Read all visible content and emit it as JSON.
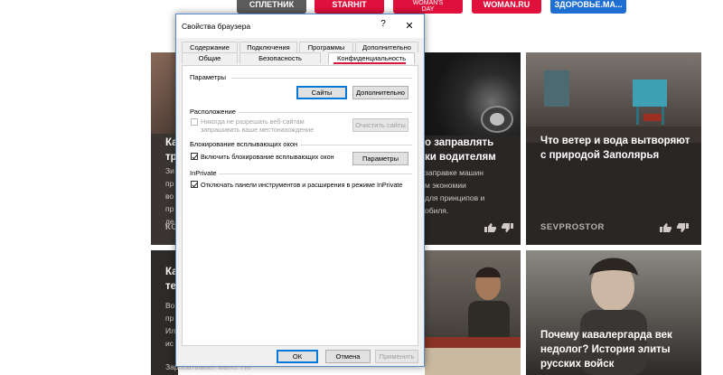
{
  "nav": {
    "items": [
      {
        "label": "СПЛЕТНИК",
        "color": "#5c5c5c"
      },
      {
        "label": "STARHIT",
        "color": "#e0103c"
      },
      {
        "label": "WOMAN'S DAY",
        "color": "#e0103c"
      },
      {
        "label": "WOMAN.RU",
        "color": "#e0103c"
      },
      {
        "label": "ЗДОРОВЬЕ.MA...",
        "color": "#1f6fd3"
      }
    ]
  },
  "cards": {
    "c1": {
      "title_start": "Ка",
      "title_start2": "тр",
      "desc": [
        "Зи",
        "пр",
        "во",
        "пр",
        "де"
      ],
      "source": "КО"
    },
    "c2": {
      "title": [
        "о заправлять",
        "ки водителям"
      ],
      "desc": [
        "заправке машин",
        "м экономии",
        "для принципов и",
        "обиля."
      ]
    },
    "c3": {
      "title": [
        "Что ветер и вода вытворяют",
        "с природой Заполярья"
      ],
      "source": "SEVPROSTOR"
    },
    "c4": {
      "title_start": "Ка",
      "title_start2": "те",
      "desc": [
        "Во",
        "пр",
        "Ил",
        "ис"
      ],
      "bottom_text": "Зарабатывает мало. Не"
    },
    "c6": {
      "title": [
        "Почему кавалергарда век",
        "недолог? История элиты",
        "русских войск"
      ]
    }
  },
  "dialog": {
    "title": "Свойства браузера",
    "help": "?",
    "close": "✕",
    "tabs_row1": [
      "Содержание",
      "Подключения",
      "Программы",
      "Дополнительно"
    ],
    "tabs_row2": [
      "Общие",
      "Безопасность",
      "Конфиденциальность"
    ],
    "settings": {
      "label": "Параметры",
      "sites_button": "Сайты",
      "advanced_button": "Дополнительно"
    },
    "location": {
      "label": "Расположение",
      "checkbox_label": [
        "Никогда не разрешать веб-сайтам",
        "запрашивать ваше местонахождение"
      ],
      "checked": false,
      "clear_button": "Очистить сайты"
    },
    "popup": {
      "label": "Блокирование всплывающих окон",
      "checkbox_label": "Включить блокирование всплывающих окон",
      "checked": true,
      "params_button": "Параметры"
    },
    "inprivate": {
      "label": "InPrivate",
      "checkbox_label": "Отключать панели инструментов и расширения в режиме InPrivate",
      "checked": true
    },
    "footer": {
      "ok": "ОК",
      "cancel": "Отмена",
      "apply": "Применить"
    }
  }
}
